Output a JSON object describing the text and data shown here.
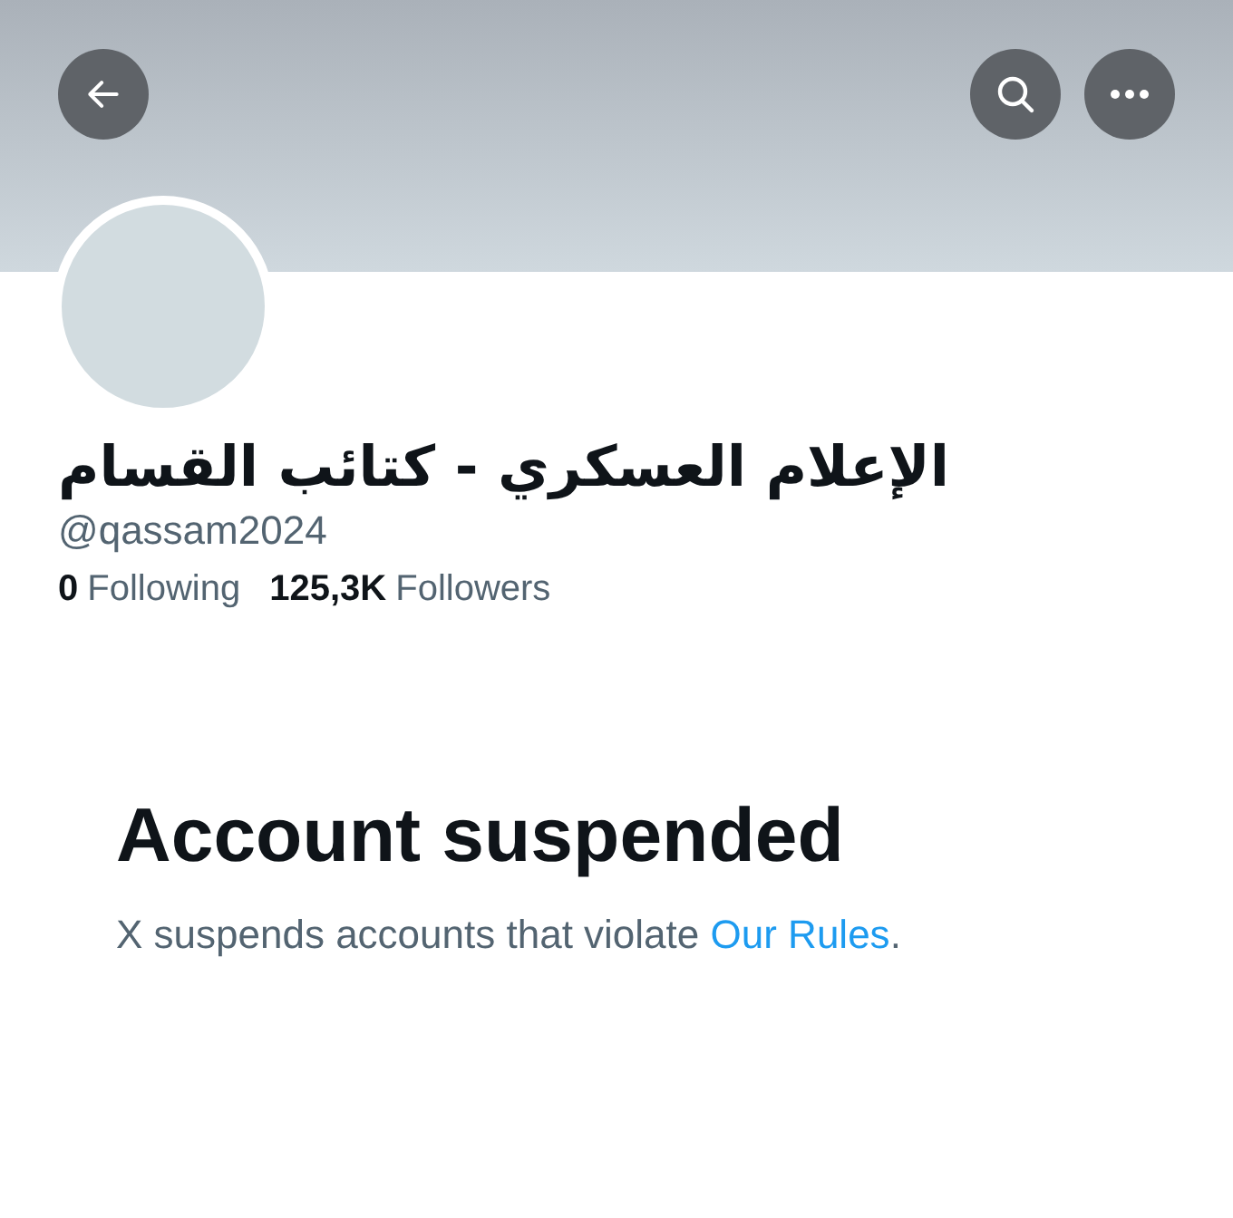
{
  "header": {
    "buttons": [
      {
        "kind": "back"
      },
      {
        "kind": "search"
      },
      {
        "kind": "more"
      }
    ]
  },
  "profile": {
    "name": "الإعلام العسكري - كتائب القسام",
    "handle": "@qassam2024",
    "stats": [
      {
        "count": "0",
        "label": "Following"
      },
      {
        "count": "125,3K",
        "label": "Followers"
      }
    ]
  },
  "notice": {
    "title": "Account suspended",
    "text_before": "X suspends accounts that violate ",
    "link": "Our Rules",
    "text_after": "."
  }
}
